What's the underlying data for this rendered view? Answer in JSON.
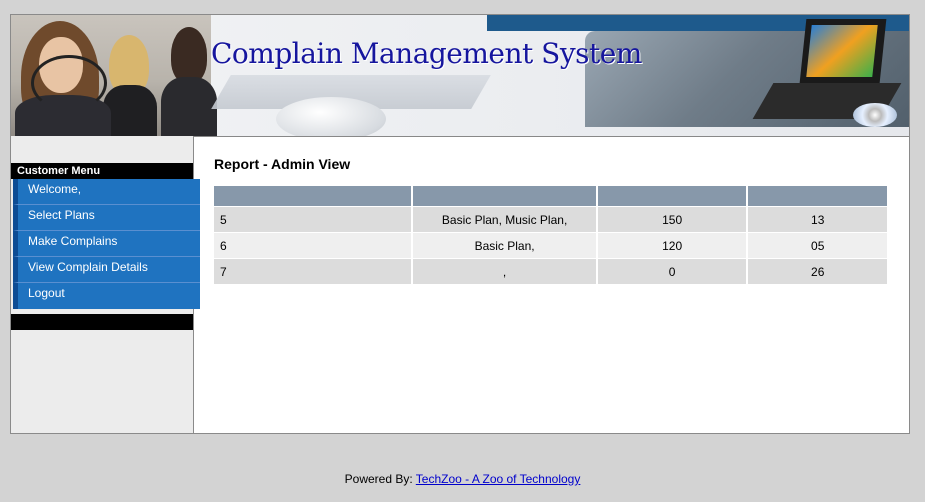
{
  "banner": {
    "title": "Complain Management System"
  },
  "sidebar": {
    "header": "Customer Menu",
    "items": [
      {
        "label": "Welcome,"
      },
      {
        "label": "Select Plans"
      },
      {
        "label": "Make Complains"
      },
      {
        "label": "View Complain Details"
      },
      {
        "label": "Logout"
      }
    ]
  },
  "main": {
    "title": "Report - Admin View",
    "table": {
      "headers": [
        "",
        "",
        "",
        ""
      ],
      "rows": [
        [
          "5",
          "Basic Plan, Music Plan,",
          "150",
          "13"
        ],
        [
          "6",
          "Basic Plan,",
          "120",
          "05"
        ],
        [
          "7",
          ",",
          "0",
          "26"
        ]
      ]
    }
  },
  "footer": {
    "prefix": "Powered By: ",
    "link_text": "TechZoo - A Zoo of Technology"
  },
  "colors": {
    "menu_bg": "#1f73c0",
    "menu_border": "#0d4c94",
    "table_header": "#8798aa",
    "title_blue": "#16169e"
  }
}
